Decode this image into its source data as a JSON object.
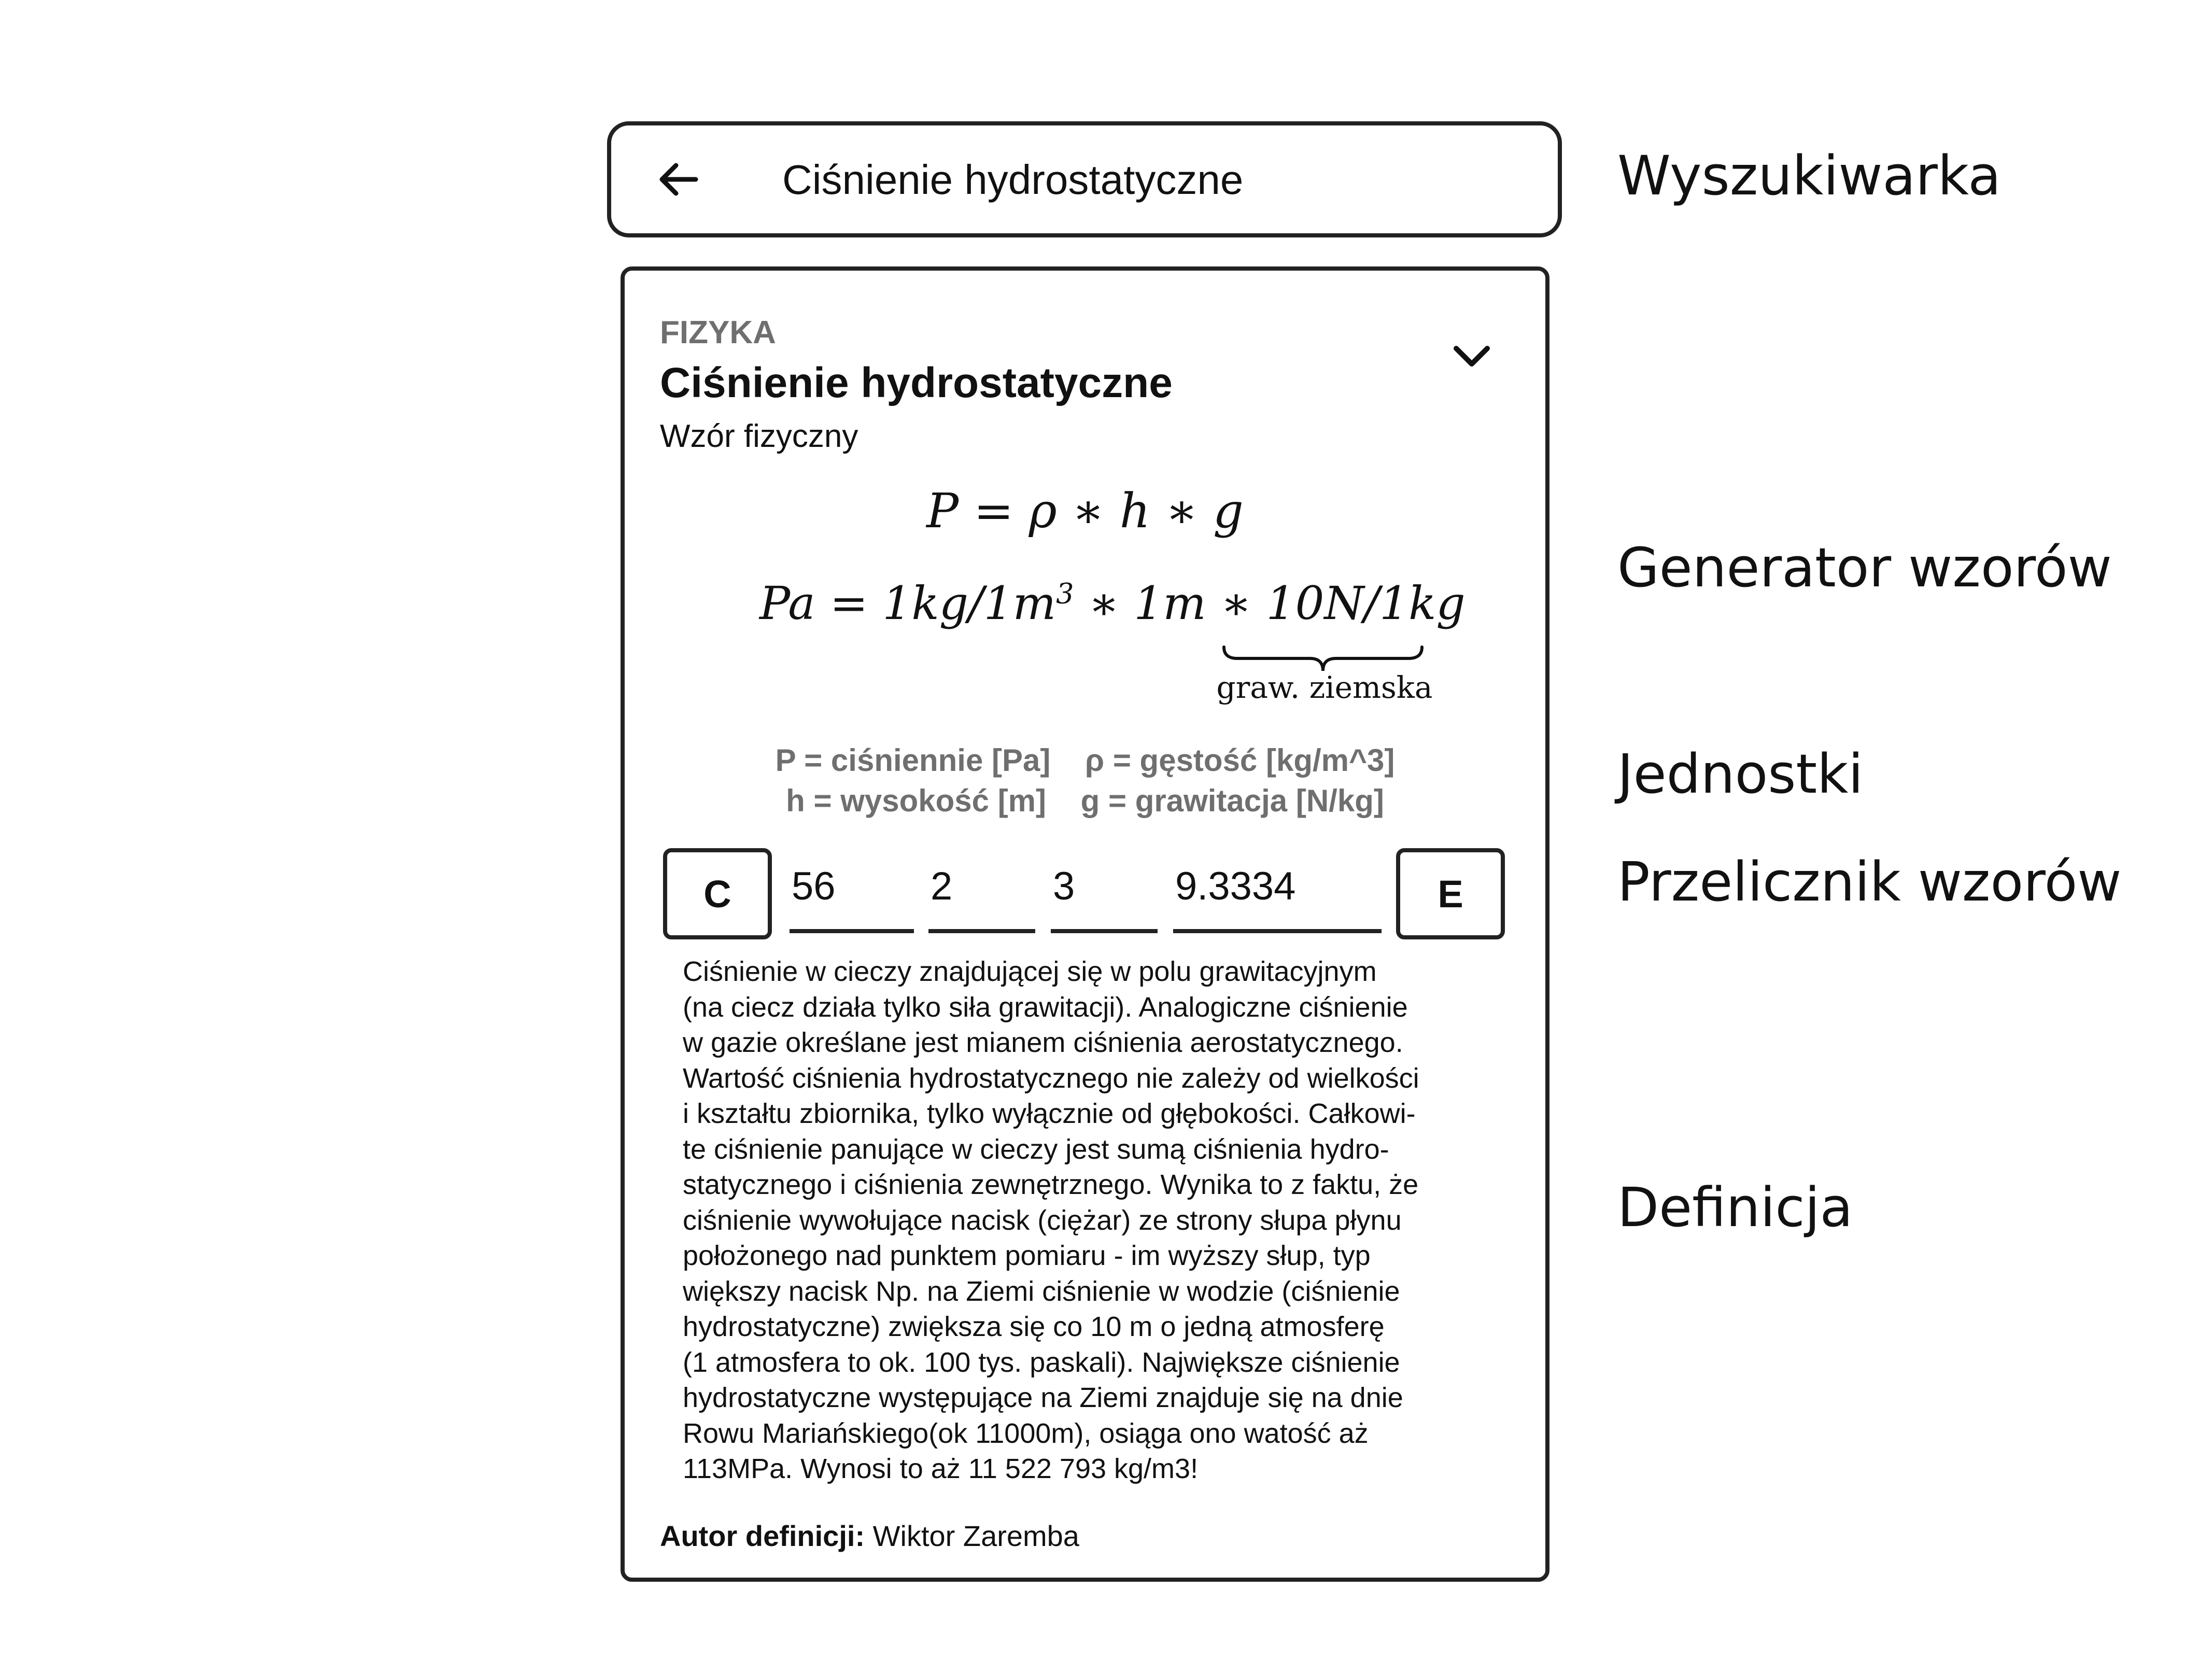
{
  "search": {
    "query": "Ciśnienie hydrostatyczne",
    "back_icon": "arrow-left-icon"
  },
  "card": {
    "category": "FIZYKA",
    "title": "Ciśnienie hydrostatyczne",
    "subtitle": "Wzór fizyczny",
    "collapse_icon": "chevron-down-icon",
    "formula": {
      "main": "P = ρ ∗ h ∗ g",
      "units_prefix": "Pa = 1kg/1m",
      "units_exponent": "3",
      "units_middle": " ∗ 1m ∗ ",
      "units_braced": "10N/1kg",
      "brace_label": "graw. ziemska"
    },
    "units": {
      "line1": "P = ciśniennie [Pa]    ρ = gęstość [kg/m^3]",
      "line2": "h = wysokość [m]    g = grawitacja [N/kg]"
    },
    "calculator": {
      "clear_label": "C",
      "enter_label": "E",
      "fields": [
        "56",
        "2",
        "3",
        "9.3334"
      ]
    },
    "definition_lines": [
      "Ciśnienie w cieczy znajdującej się w polu grawitacyjnym",
      "(na ciecz działa tylko siła grawitacji). Analogiczne ciśnienie",
      "w gazie określane jest mianem ciśnienia aerostatycznego.",
      "Wartość ciśnienia hydrostatycznego nie zależy od wielkości",
      "i kształtu zbiornika, tylko wyłącznie od głębokości. Całkowi-",
      "te ciśnienie panujące w cieczy jest sumą ciśnienia hydro-",
      "statycznego i ciśnienia zewnętrznego. Wynika to z faktu, że",
      "ciśnienie wywołujące  nacisk (ciężar) ze strony słupa płynu",
      "położonego nad punktem pomiaru - im wyższy słup, typ",
      "większy nacisk  Np. na Ziemi ciśnienie w wodzie (ciśnienie",
      "hydrostatyczne)  zwiększa się co 10 m o jedną atmosferę",
      "(1 atmosfera to ok. 100 tys. paskali). Największe ciśnienie",
      "hydrostatyczne występujące na Ziemi znajduje się na dnie",
      "Rowu Mariańskiego(ok 11000m), osiąga ono watość aż",
      "113MPa. Wynosi to aż 11 522 793 kg/m3!"
    ],
    "author_label": "Autor definicji:",
    "author_name": " Wiktor Zaremba"
  },
  "annotations": {
    "search": "Wyszukiwarka",
    "generator": "Generator wzorów",
    "units": "Jednostki",
    "calculator": "Przelicznik wzorów",
    "definition": "Definicja"
  }
}
